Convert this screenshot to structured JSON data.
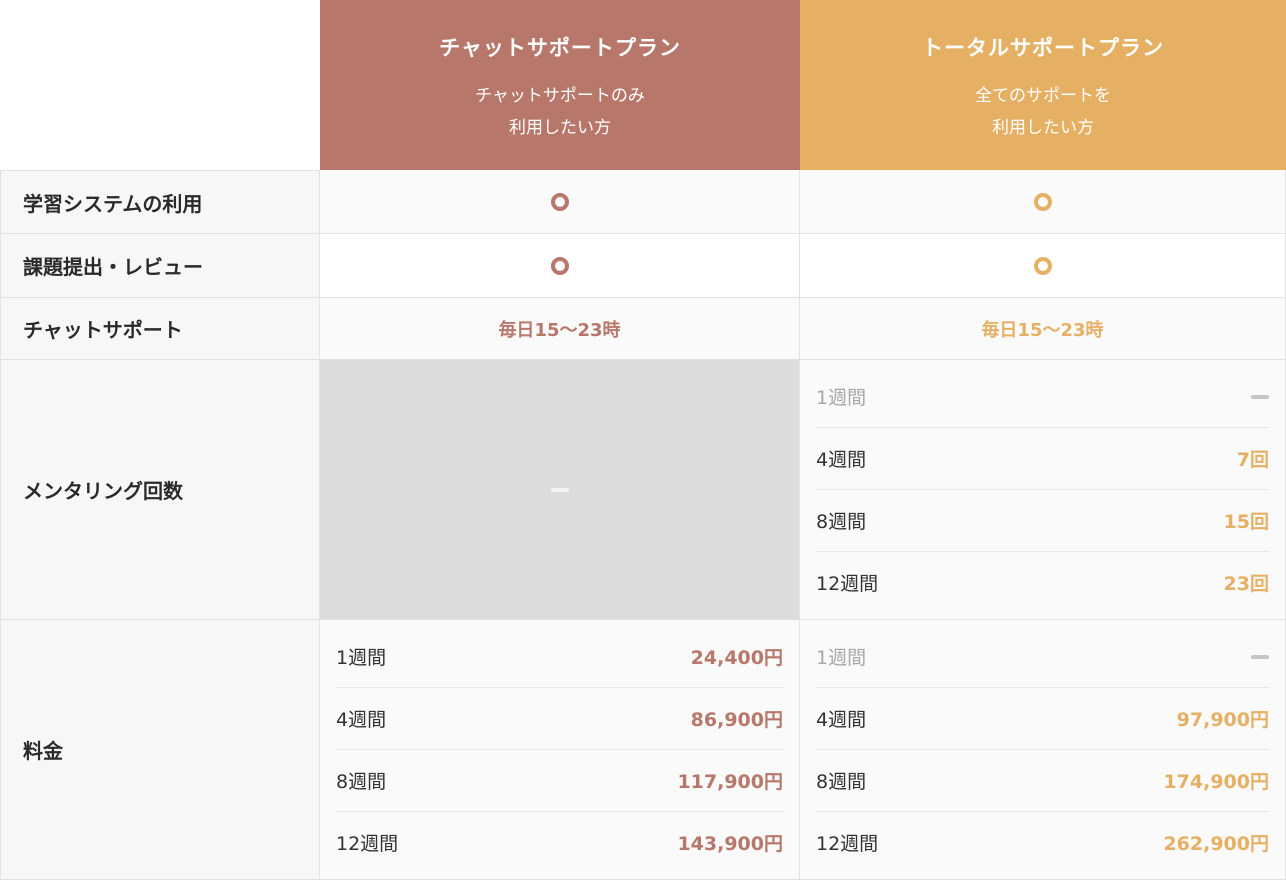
{
  "plans": {
    "chat": {
      "title": "チャットサポートプラン",
      "desc_line1": "チャットサポートのみ",
      "desc_line2": "利用したい方",
      "color": "#b8776b"
    },
    "total": {
      "title": "トータルサポートプラン",
      "desc_line1": "全てのサポートを",
      "desc_line2": "利用したい方",
      "color": "#e6b064"
    }
  },
  "rows": {
    "learning_system": {
      "label": "学習システムの利用",
      "chat_icon": "circle-icon",
      "total_icon": "circle-icon"
    },
    "assignment_review": {
      "label": "課題提出・レビュー",
      "chat_icon": "circle-icon",
      "total_icon": "circle-icon"
    },
    "chat_support": {
      "label": "チャットサポート",
      "chat_value": "毎日15〜23時",
      "total_value": "毎日15〜23時"
    },
    "mentoring": {
      "label": "メンタリング回数",
      "chat_icon": "dash-icon",
      "total": [
        {
          "period": "1週間",
          "value": "",
          "icon": "dash-icon"
        },
        {
          "period": "4週間",
          "value": "7回"
        },
        {
          "period": "8週間",
          "value": "15回"
        },
        {
          "period": "12週間",
          "value": "23回"
        }
      ]
    },
    "price": {
      "label": "料金",
      "chat": [
        {
          "period": "1週間",
          "value": "24,400円"
        },
        {
          "period": "4週間",
          "value": "86,900円"
        },
        {
          "period": "8週間",
          "value": "117,900円"
        },
        {
          "period": "12週間",
          "value": "143,900円"
        }
      ],
      "total": [
        {
          "period": "1週間",
          "value": "",
          "icon": "dash-icon"
        },
        {
          "period": "4週間",
          "value": "97,900円"
        },
        {
          "period": "8週間",
          "value": "174,900円"
        },
        {
          "period": "12週間",
          "value": "262,900円"
        }
      ]
    }
  }
}
